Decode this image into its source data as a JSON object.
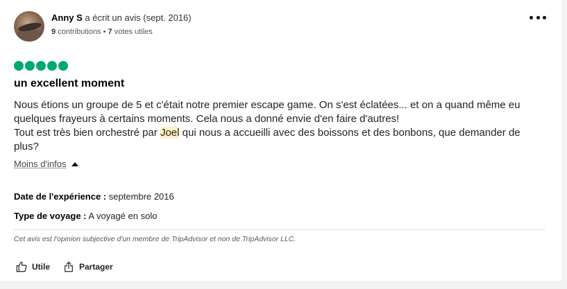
{
  "author": {
    "name": "Anny S",
    "action_text": "a écrit un avis (sept. 2016)",
    "contributions_count": "9",
    "contributions_label": "contributions",
    "separator": "•",
    "votes_count": "7",
    "votes_label": "votes utiles"
  },
  "menu": {
    "label": "•••"
  },
  "review": {
    "rating": 5,
    "rating_max": 5,
    "rating_color": "#00aa6c",
    "title": "un excellent moment",
    "paragraph1": "Nous étions un groupe de 5 et c'était notre premier escape game. On s'est éclatées... et on a quand même eu quelques frayeurs à certains moments. Cela nous a donné envie d'en faire d'autres!",
    "paragraph2_before": "Tout est très bien orchestré par ",
    "paragraph2_highlight": "Joel",
    "paragraph2_after": " qui nous a accueilli avec des boissons et des bonbons, que demander de plus?",
    "toggle_label": "Moins d'infos",
    "highlight_color": "#fff1c2"
  },
  "details": {
    "experience_label": "Date de l'expérience :",
    "experience_value": "septembre 2016",
    "trip_type_label": "Type de voyage :",
    "trip_type_value": "A voyagé en solo"
  },
  "disclaimer": "Cet avis est l'opinion subjective d'un membre de TripAdvisor et non de TripAdvisor LLC.",
  "actions": {
    "helpful_label": "Utile",
    "share_label": "Partager"
  }
}
